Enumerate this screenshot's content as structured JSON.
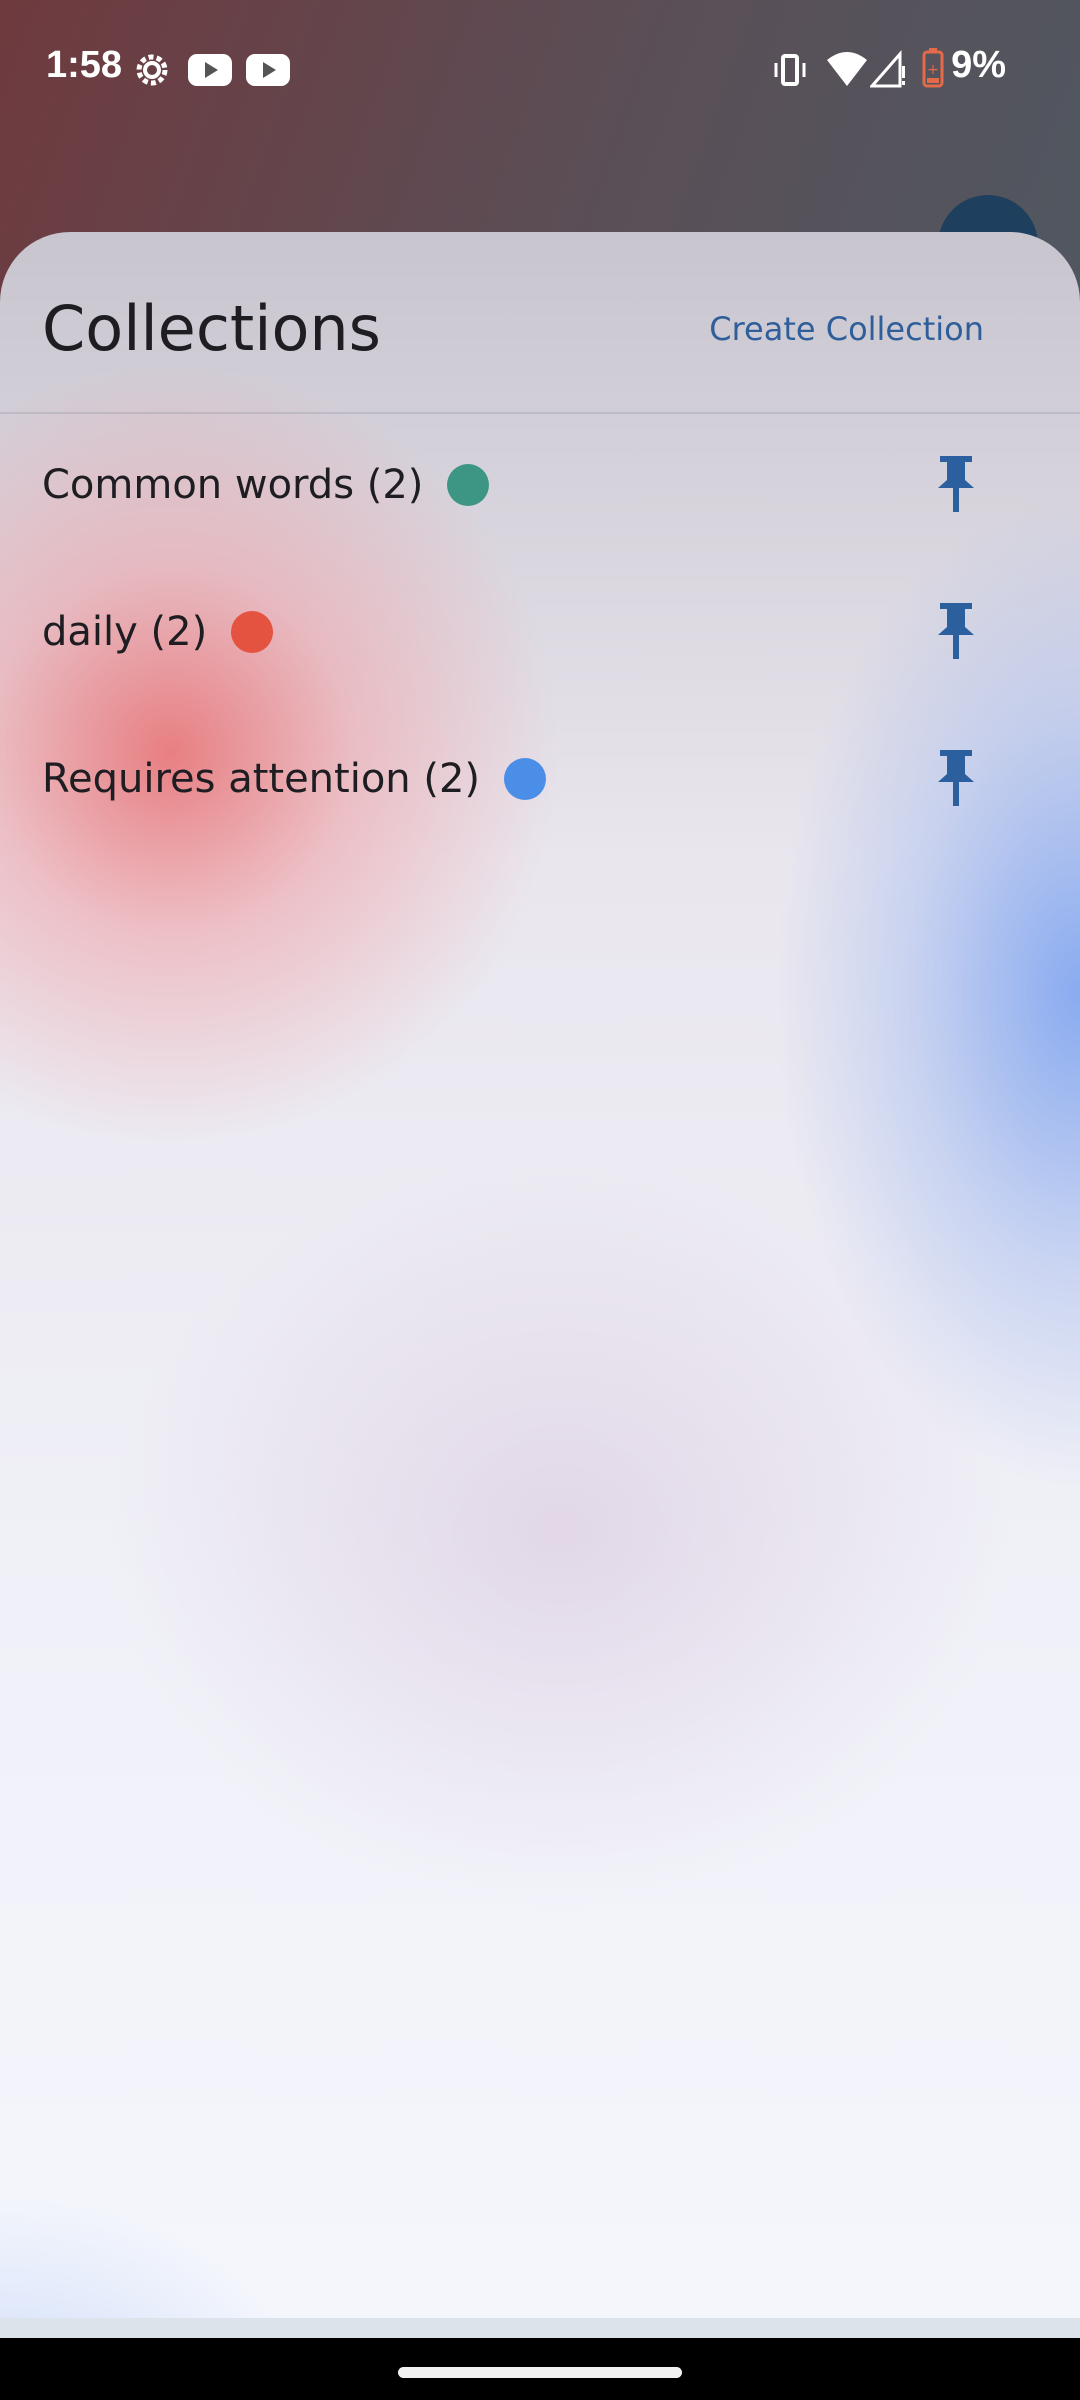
{
  "status_bar": {
    "time": "1:58",
    "battery_percent": "9%",
    "icons": [
      "settings-gear-icon",
      "youtube-icon",
      "youtube-icon",
      "vibrate-icon",
      "wifi-icon",
      "cell-signal-icon",
      "battery-low-icon"
    ]
  },
  "sheet": {
    "title": "Collections",
    "create_label": "Create Collection",
    "collections": [
      {
        "label": "Common words (2)",
        "color": "#3d9683",
        "pin_icon": "pin-icon"
      },
      {
        "label": "daily (2)",
        "color": "#e4533f",
        "pin_icon": "pin-icon"
      },
      {
        "label": "Requires attention (2)",
        "color": "#4a8ee8",
        "pin_icon": "pin-icon"
      }
    ]
  },
  "colors": {
    "accent": "#2f5f9a",
    "pin": "#2b5f9e"
  }
}
